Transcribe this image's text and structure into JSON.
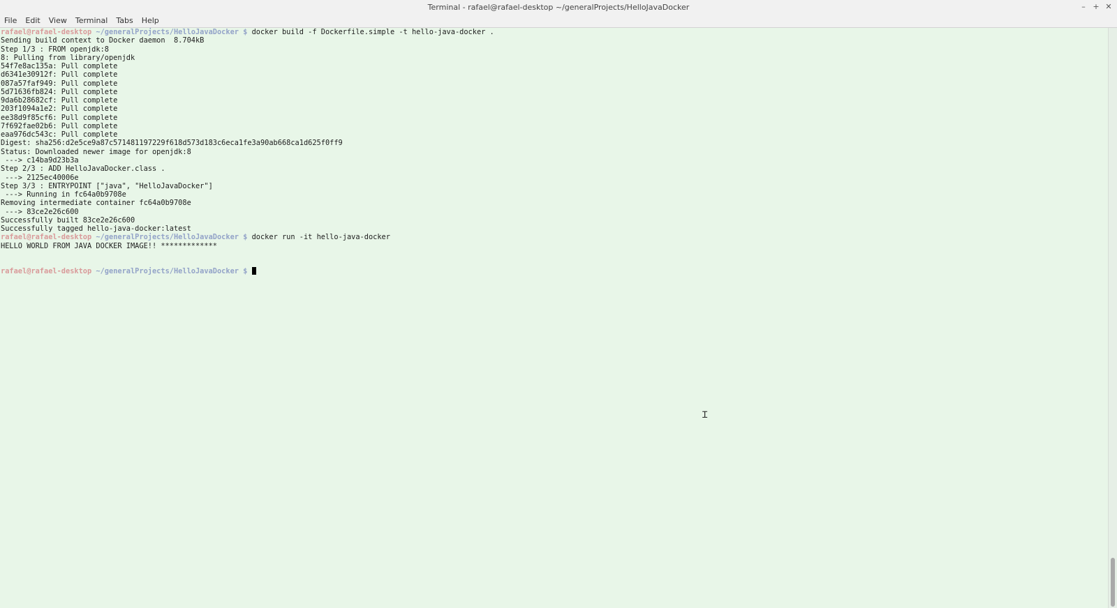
{
  "window": {
    "title": "Terminal - rafael@rafael-desktop ~/generalProjects/HelloJavaDocker",
    "controls": [
      "minimize-icon",
      "maximize-icon",
      "close-icon"
    ]
  },
  "menu": [
    "File",
    "Edit",
    "View",
    "Terminal",
    "Tabs",
    "Help"
  ],
  "prompt": {
    "user": "rafael@rafael-desktop",
    "path": "~/generalProjects/HelloJavaDocker",
    "symbol": "$"
  },
  "lines": [
    {
      "kind": "prompt",
      "text": "docker build -f Dockerfile.simple -t hello-java-docker ."
    },
    {
      "kind": "out",
      "text": "Sending build context to Docker daemon  8.704kB"
    },
    {
      "kind": "out",
      "text": "Step 1/3 : FROM openjdk:8"
    },
    {
      "kind": "out",
      "text": "8: Pulling from library/openjdk"
    },
    {
      "kind": "out",
      "text": "54f7e8ac135a: Pull complete"
    },
    {
      "kind": "out",
      "text": "d6341e30912f: Pull complete"
    },
    {
      "kind": "out",
      "text": "087a57faf949: Pull complete"
    },
    {
      "kind": "out",
      "text": "5d71636fb824: Pull complete"
    },
    {
      "kind": "out",
      "text": "9da6b28682cf: Pull complete"
    },
    {
      "kind": "out",
      "text": "203f1094a1e2: Pull complete"
    },
    {
      "kind": "out",
      "text": "ee38d9f85cf6: Pull complete"
    },
    {
      "kind": "out",
      "text": "7f692fae02b6: Pull complete"
    },
    {
      "kind": "out",
      "text": "eaa976dc543c: Pull complete"
    },
    {
      "kind": "out",
      "text": "Digest: sha256:d2e5ce9a87c571481197229f618d573d183c6eca1fe3a90ab668ca1d625f0ff9"
    },
    {
      "kind": "out",
      "text": "Status: Downloaded newer image for openjdk:8"
    },
    {
      "kind": "out",
      "text": " ---> c14ba9d23b3a"
    },
    {
      "kind": "out",
      "text": "Step 2/3 : ADD HelloJavaDocker.class ."
    },
    {
      "kind": "out",
      "text": " ---> 2125ec40006e"
    },
    {
      "kind": "out",
      "text": "Step 3/3 : ENTRYPOINT [\"java\", \"HelloJavaDocker\"]"
    },
    {
      "kind": "out",
      "text": " ---> Running in fc64a0b9708e"
    },
    {
      "kind": "out",
      "text": "Removing intermediate container fc64a0b9708e"
    },
    {
      "kind": "out",
      "text": " ---> 83ce2e26c600"
    },
    {
      "kind": "out",
      "text": "Successfully built 83ce2e26c600"
    },
    {
      "kind": "out",
      "text": "Successfully tagged hello-java-docker:latest"
    },
    {
      "kind": "prompt",
      "text": "docker run -it hello-java-docker"
    },
    {
      "kind": "out",
      "text": "HELLO WORLD FROM JAVA DOCKER IMAGE!! *************"
    },
    {
      "kind": "out",
      "text": ""
    },
    {
      "kind": "out",
      "text": ""
    },
    {
      "kind": "prompt",
      "text": "",
      "cursor": true
    }
  ],
  "colors": {
    "background": "#e8f6e8",
    "prompt_user": "#d99a9a",
    "prompt_path": "#93a3c8",
    "text": "#1d1d1d"
  }
}
